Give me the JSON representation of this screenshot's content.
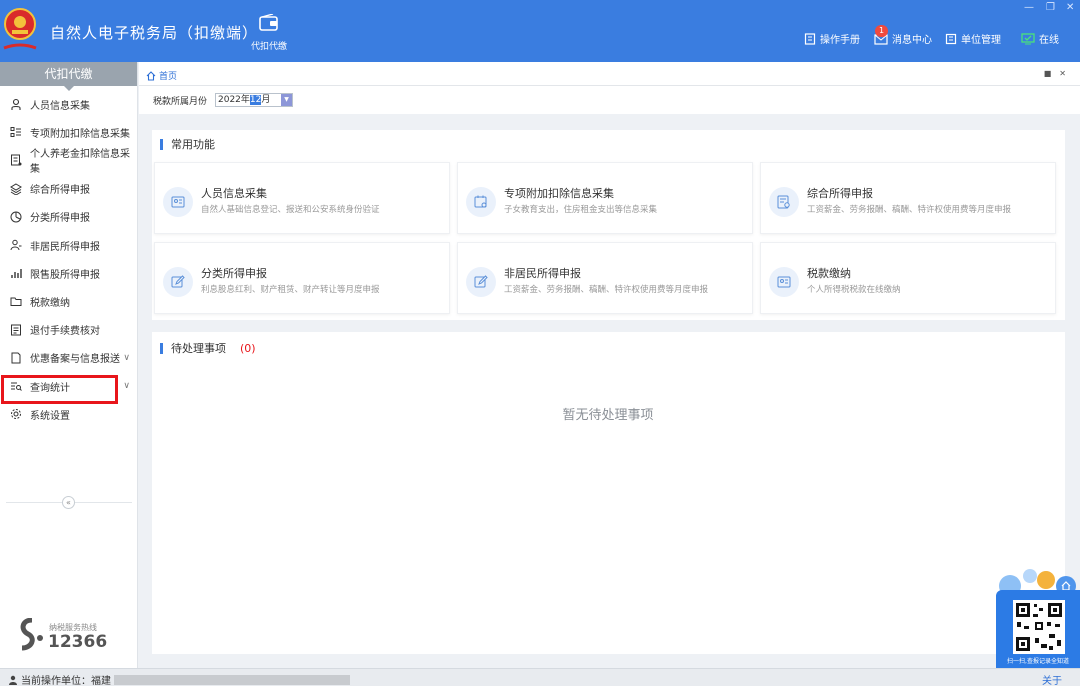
{
  "header": {
    "app_title": "自然人电子税务局（扣缴端）",
    "module_label": "代扣代缴",
    "manual_label": "操作手册",
    "message_center_label": "消息中心",
    "message_badge": "1",
    "unit_mgmt_label": "单位管理",
    "online_label": "在线",
    "accent_color": "#3a7de0"
  },
  "sidebar": {
    "title": "代扣代缴",
    "items": [
      {
        "label": "人员信息采集",
        "icon": "person-icon"
      },
      {
        "label": "专项附加扣除信息采集",
        "icon": "list-icon"
      },
      {
        "label": "个人养老金扣除信息采集",
        "icon": "pension-doc-icon"
      },
      {
        "label": "综合所得申报",
        "icon": "layers-icon"
      },
      {
        "label": "分类所得申报",
        "icon": "pie-icon"
      },
      {
        "label": "非居民所得申报",
        "icon": "user-icon"
      },
      {
        "label": "限售股所得申报",
        "icon": "bar-chart-icon"
      },
      {
        "label": "税款缴纳",
        "icon": "folder-icon"
      },
      {
        "label": "退付手续费核对",
        "icon": "receipt-icon"
      },
      {
        "label": "优惠备案与信息报送",
        "icon": "doc-icon"
      },
      {
        "label": "查询统计",
        "icon": "search-list-icon"
      },
      {
        "label": "系统设置",
        "icon": "gear-icon"
      }
    ],
    "hotline_label": "纳税服务热线",
    "hotline_number": "12366",
    "highlight_color": "#e8161b"
  },
  "tabs": {
    "home_label": "首页"
  },
  "period": {
    "label": "税款所属月份",
    "value_year": "2022年",
    "value_month": "12",
    "value_suffix": "月"
  },
  "common": {
    "title": "常用功能",
    "cards": [
      {
        "title": "人员信息采集",
        "desc": "自然人基础信息登记、报送和公安系统身份验证"
      },
      {
        "title": "专项附加扣除信息采集",
        "desc": "子女教育支出，住房租金支出等信息采集"
      },
      {
        "title": "综合所得申报",
        "desc": "工资薪金、劳务报酬、稿酬、特许权使用费等月度申报"
      },
      {
        "title": "分类所得申报",
        "desc": "利息股息红利、财产租赁、财产转让等月度申报"
      },
      {
        "title": "非居民所得申报",
        "desc": "工资薪金、劳务报酬、稿酬、特许权使用费等月度申报"
      },
      {
        "title": "税款缴纳",
        "desc": "个人所得税税款在线缴纳"
      }
    ]
  },
  "pending": {
    "title": "待处理事项",
    "count": "(0)",
    "empty_message": "暂无待处理事项"
  },
  "status": {
    "unit_label": "当前操作单位：",
    "unit_value": "福建",
    "about_label": "关于"
  },
  "qr_widget": {
    "caption": "扫一扫,查报记录全知道"
  }
}
